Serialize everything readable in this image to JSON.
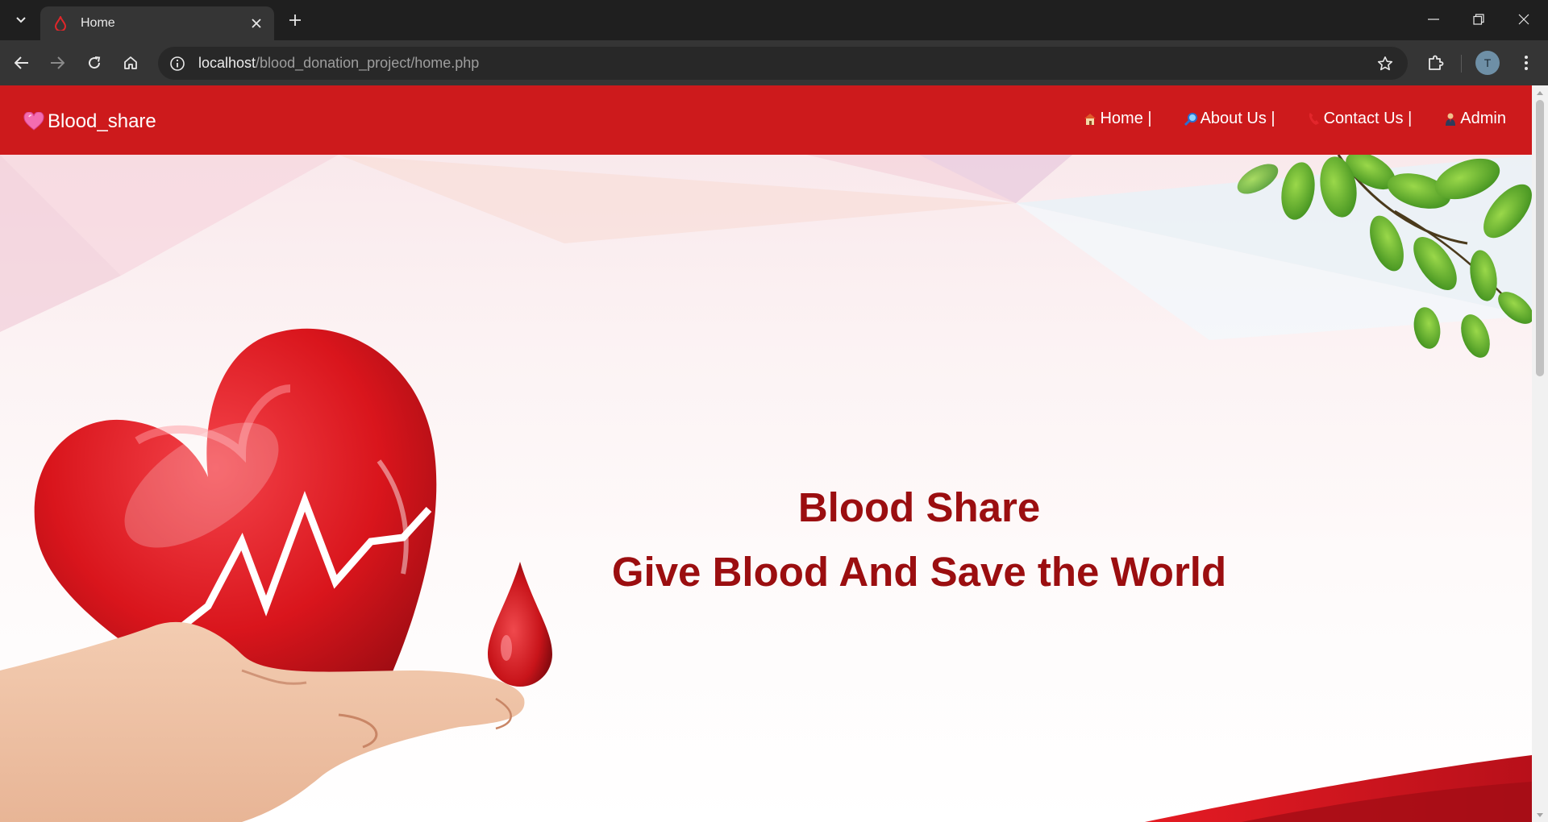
{
  "browser": {
    "tab": {
      "title": "Home",
      "favicon": "blood-drop-icon"
    },
    "address": {
      "host": "localhost",
      "path": "/blood_donation_project/home.php"
    },
    "profile_initial": "T",
    "colors": {
      "frame": "#1f1f1f",
      "toolbar": "#353535",
      "omnibox": "#282828"
    }
  },
  "site": {
    "brand": "Blood_share",
    "brand_icon": "sparkling-heart-icon",
    "nav": [
      {
        "label": "Home |",
        "icon": "house-icon"
      },
      {
        "label": "About Us |",
        "icon": "magnifier-icon"
      },
      {
        "label": "Contact Us |",
        "icon": "telephone-icon"
      },
      {
        "label": "Admin",
        "icon": "person-icon"
      }
    ],
    "hero": {
      "title": "Blood Share",
      "subtitle": "Give Blood And Save the World"
    },
    "colors": {
      "navbar": "#cd1a1c",
      "hero_text": "#9b0e10"
    }
  }
}
